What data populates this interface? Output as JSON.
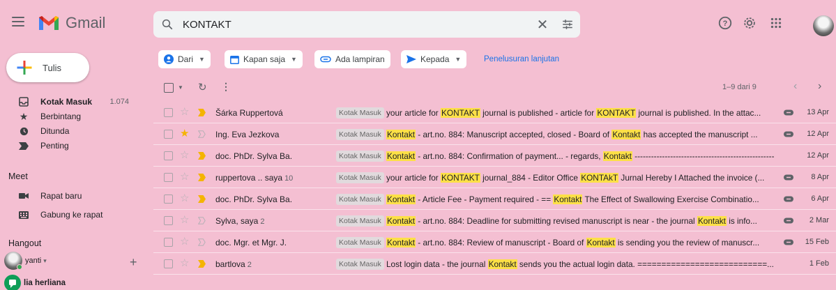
{
  "app": {
    "name": "Gmail"
  },
  "search": {
    "value": "KONTAKT"
  },
  "compose": {
    "label": "Tulis"
  },
  "nav": [
    {
      "label": "Kotak Masuk",
      "count": "1.074",
      "icon": "inbox-icon",
      "active": true
    },
    {
      "label": "Berbintang",
      "count": "",
      "icon": "star-icon"
    },
    {
      "label": "Ditunda",
      "count": "",
      "icon": "clock-icon"
    },
    {
      "label": "Penting",
      "count": "",
      "icon": "important-icon"
    }
  ],
  "meet": {
    "title": "Meet",
    "items": [
      {
        "label": "Rapat baru",
        "icon": "video-icon"
      },
      {
        "label": "Gabung ke rapat",
        "icon": "keyboard-icon"
      }
    ]
  },
  "hangout": {
    "title": "Hangout",
    "users": [
      {
        "name": "yanti",
        "suffix": "▾"
      },
      {
        "name": "lia herliana"
      }
    ]
  },
  "filters": [
    {
      "label": "Dari",
      "icon": "person-icon"
    },
    {
      "label": "Kapan saja",
      "icon": "calendar-icon"
    },
    {
      "label": "Ada lampiran",
      "icon": "attachment-icon"
    },
    {
      "label": "Kepada",
      "icon": "send-icon"
    }
  ],
  "advanced_search": "Penelusuran lanjutan",
  "pager": {
    "text": "1–9 dari 9"
  },
  "emails": [
    {
      "sender": "Šárka Ruppertová",
      "count": "",
      "starred": false,
      "important": true,
      "label": "Kotak Masuk",
      "parts": [
        "your article for ",
        "KONTAKT",
        " journal is published - article for ",
        "KONTAKT",
        " journal is published. In the attac..."
      ],
      "attach": true,
      "date": "13 Apr"
    },
    {
      "sender": "Ing. Eva Jezkova",
      "count": "",
      "starred": true,
      "important": false,
      "label": "Kotak Masuk",
      "parts": [
        "",
        "Kontakt",
        " - art.no. 884: Manuscript accepted, closed - Board of ",
        "Kontakt",
        " has accepted the manuscript ..."
      ],
      "attach": true,
      "date": "12 Apr"
    },
    {
      "sender": "doc. PhDr. Sylva Ba.",
      "count": "",
      "starred": false,
      "important": true,
      "label": "Kotak Masuk",
      "parts": [
        "",
        "Kontakt",
        " - art.no. 884: Confirmation of payment... - regards, ",
        "Kontakt",
        " -----------------------------------------------------..."
      ],
      "attach": false,
      "date": "12 Apr"
    },
    {
      "sender": "ruppertova .. saya",
      "count": "10",
      "starred": false,
      "important": true,
      "label": "Kotak Masuk",
      "parts": [
        "your article for ",
        "KONTAKT",
        " journal_884 - Editor Office ",
        "KONTAkT",
        " Jurnal Hereby I Attached the invoice (..."
      ],
      "attach": true,
      "date": "8 Apr"
    },
    {
      "sender": "doc. PhDr. Sylva Ba.",
      "count": "",
      "starred": false,
      "important": true,
      "label": "Kotak Masuk",
      "parts": [
        "",
        "Kontakt",
        " - Article Fee - Payment required - == ",
        "Kontakt",
        " The Effect of Swallowing Exercise Combinatio..."
      ],
      "attach": true,
      "date": "6 Apr"
    },
    {
      "sender": "Sylva, saya",
      "count": "2",
      "starred": false,
      "important": false,
      "label": "Kotak Masuk",
      "parts": [
        "",
        "Kontakt",
        " - art.no. 884: Deadline for submitting revised manuscript is near - the journal ",
        "Kontakt",
        " is info..."
      ],
      "attach": true,
      "date": "2 Mar"
    },
    {
      "sender": "doc. Mgr. et Mgr. J.",
      "count": "",
      "starred": false,
      "important": false,
      "label": "Kotak Masuk",
      "parts": [
        "",
        "Kontakt",
        " - art.no. 884: Review of manuscript - Board of ",
        "Kontakt",
        " is sending you the review of manuscr..."
      ],
      "attach": true,
      "date": "15 Feb"
    },
    {
      "sender": "bartlova",
      "count": "2",
      "starred": false,
      "important": true,
      "label": "Kotak Masuk",
      "parts": [
        "Lost login data - the journal ",
        "Kontakt",
        " sends you the actual login data. ===========================..."
      ],
      "attach": false,
      "date": "1 Feb"
    }
  ]
}
